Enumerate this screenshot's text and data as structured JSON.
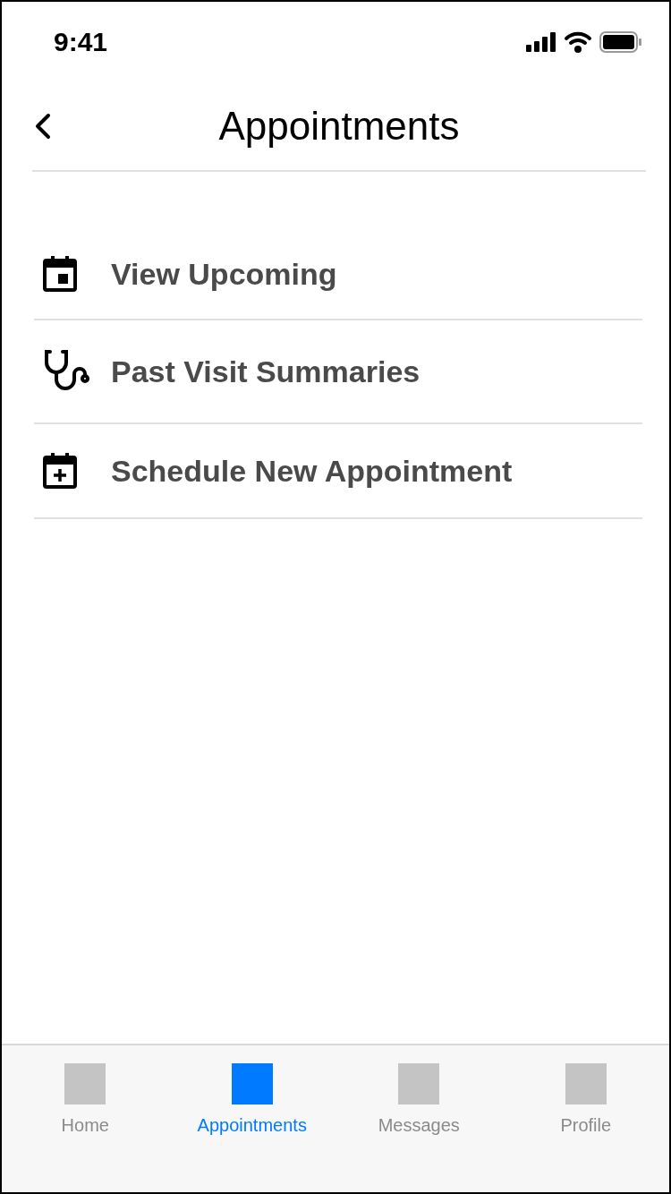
{
  "status_bar": {
    "time": "9:41"
  },
  "header": {
    "title": "Appointments"
  },
  "menu_items": [
    {
      "label": "View Upcoming",
      "kind": "calendar"
    },
    {
      "label": "Past Visit Summaries",
      "kind": "stethoscope"
    },
    {
      "label": "Schedule New Appointment",
      "kind": "calendar-plus"
    }
  ],
  "tab_bar": [
    {
      "label": "Home",
      "selected": false
    },
    {
      "label": "Appointments",
      "selected": true
    },
    {
      "label": "Messages",
      "selected": false
    },
    {
      "label": "Profile",
      "selected": false
    }
  ]
}
